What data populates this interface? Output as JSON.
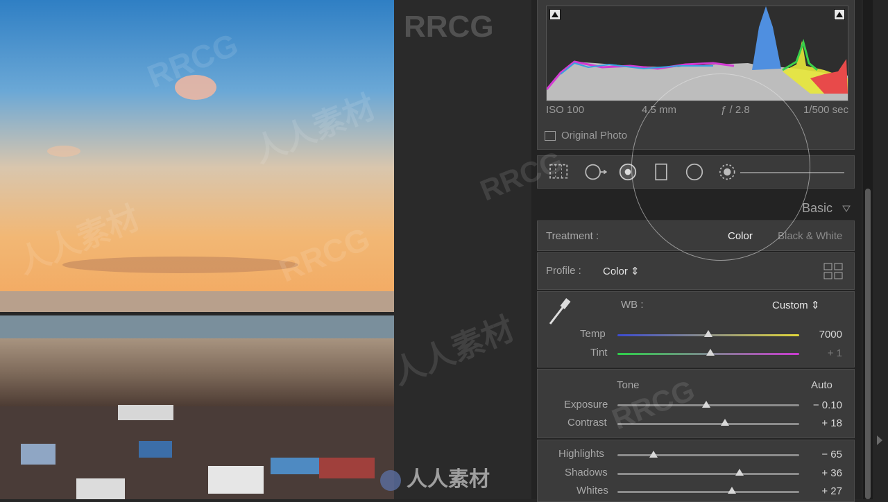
{
  "histogram": {
    "iso": "ISO 100",
    "focal": "4.5 mm",
    "aperture": "ƒ / 2.8",
    "shutter": "1/500 sec",
    "original_photo_label": "Original Photo"
  },
  "tools": [
    "crop-icon",
    "spot-removal-icon",
    "red-eye-icon",
    "graduated-filter-icon",
    "radial-filter-icon",
    "adjustment-brush-icon"
  ],
  "basic": {
    "title": "Basic",
    "treatment_label": "Treatment :",
    "treatment_color": "Color",
    "treatment_bw": "Black & White",
    "profile_label": "Profile :",
    "profile_value": "Color ⇕",
    "wb_label": "WB :",
    "wb_value": "Custom ⇕",
    "tone_label": "Tone",
    "auto_label": "Auto",
    "sliders": [
      {
        "label": "Temp",
        "value": "7000",
        "pos": 0.5
      },
      {
        "label": "Tint",
        "value": "+ 1",
        "pos": 0.51
      },
      {
        "label": "Exposure",
        "value": "− 0.10",
        "pos": 0.49
      },
      {
        "label": "Contrast",
        "value": "+ 18",
        "pos": 0.59
      },
      {
        "label": "Highlights",
        "value": "− 65",
        "pos": 0.2
      },
      {
        "label": "Shadows",
        "value": "+ 36",
        "pos": 0.67
      },
      {
        "label": "Whites",
        "value": "+ 27",
        "pos": 0.63
      }
    ]
  },
  "watermarks": [
    "RRCG",
    "人人素材"
  ]
}
